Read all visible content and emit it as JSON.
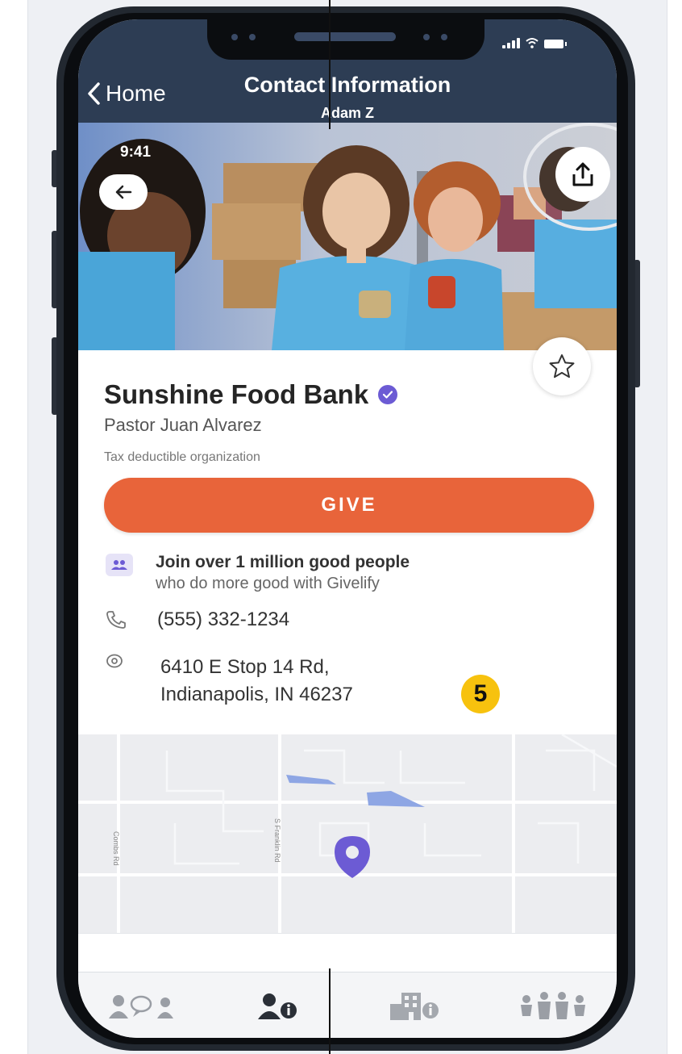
{
  "nav": {
    "back_label": "Home",
    "title": "Contact Information",
    "subtitle": "Adam Z"
  },
  "hero": {
    "inner_time": "9:41"
  },
  "org": {
    "name": "Sunshine Food Bank",
    "contact": "Pastor Juan Alvarez",
    "tax_status": "Tax deductible organization",
    "give_label": "GIVE",
    "join_line1": "Join over 1 million good people",
    "join_line2": "who do more good with Givelify",
    "phone": "(555) 332-1234",
    "address_line1": "6410 E Stop 14 Rd,",
    "address_line2": "Indianapolis, IN 46237"
  },
  "map": {
    "road1": "Combs Rd",
    "road2": "S Franklin Rd"
  },
  "tabs": [
    {
      "icon": "people-chat-icon",
      "active": false
    },
    {
      "icon": "person-info-icon",
      "active": true
    },
    {
      "icon": "building-info-icon",
      "active": false
    },
    {
      "icon": "family-icon",
      "active": false
    }
  ],
  "annotation_marker": "5",
  "colors": {
    "header": "#2d3d54",
    "give": "#e8643a",
    "accent": "#6c5bd4",
    "marker": "#f7c20e"
  }
}
